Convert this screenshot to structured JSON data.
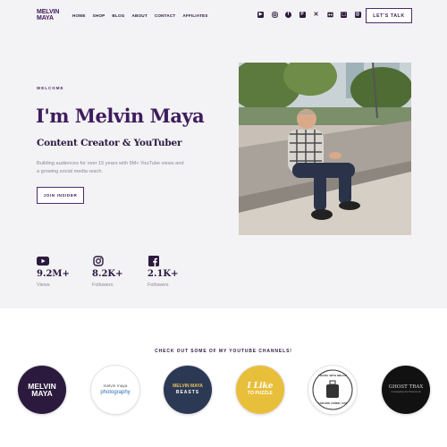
{
  "header": {
    "logo_line1": "MELVIN",
    "logo_line2": "MAYA",
    "nav": [
      "HOME",
      "SHOP",
      "BLOG",
      "ABOUT",
      "CONTACT",
      "AFFILIATES"
    ],
    "social_icons": [
      "youtube-icon",
      "instagram-icon",
      "facebook-icon",
      "pinterest-icon",
      "x-icon",
      "flickr-icon",
      "store-icon",
      "threads-icon",
      "behance-icon"
    ],
    "behance_text": "Be",
    "cta_label": "LET'S TALK"
  },
  "hero": {
    "eyebrow": "WELCOME",
    "title": "I'm Melvin Maya",
    "subtitle": "Content Creator & YouTuber",
    "description": "Building audiences for over 15 years with 9M+ YouTube views and a growing social media reach.",
    "button_label": "JOIN INSIDER"
  },
  "stats": [
    {
      "icon": "youtube-icon",
      "value": "9.2M+",
      "label": "Views"
    },
    {
      "icon": "instagram-icon",
      "value": "8.2K+",
      "label": "Followers"
    },
    {
      "icon": "facebook-icon",
      "value": "2.1K+",
      "label": "Followers"
    }
  ],
  "channels": {
    "title": "CHECK OUT SOME OF MY YOUTUBE CHANNELS!",
    "items": [
      {
        "name": "melvin-maya",
        "line1": "MELVIN",
        "line2": "MAYA"
      },
      {
        "name": "melvin-maya-photography",
        "line1": "melvin maya",
        "line2": "photography"
      },
      {
        "name": "melvin-maya-beasts",
        "line1": "MELVIN MAYA",
        "line2": "BEASTS"
      },
      {
        "name": "i-like-to-puzzle",
        "line1": "I Like",
        "line2": "TO PUZZLE"
      },
      {
        "name": "travel-with-melvin",
        "line1": "TRAVEL WITH MELVIN",
        "line2": "EXPLORE | DRINK | EAT"
      },
      {
        "name": "ghost-tracks",
        "line1": "GHOST TRAX",
        "line2": "Investigating the Paranormal"
      }
    ]
  },
  "colors": {
    "brand": "#3d1c5c",
    "hero_bg": "#f3f2f4",
    "text_muted": "#8c8794"
  }
}
